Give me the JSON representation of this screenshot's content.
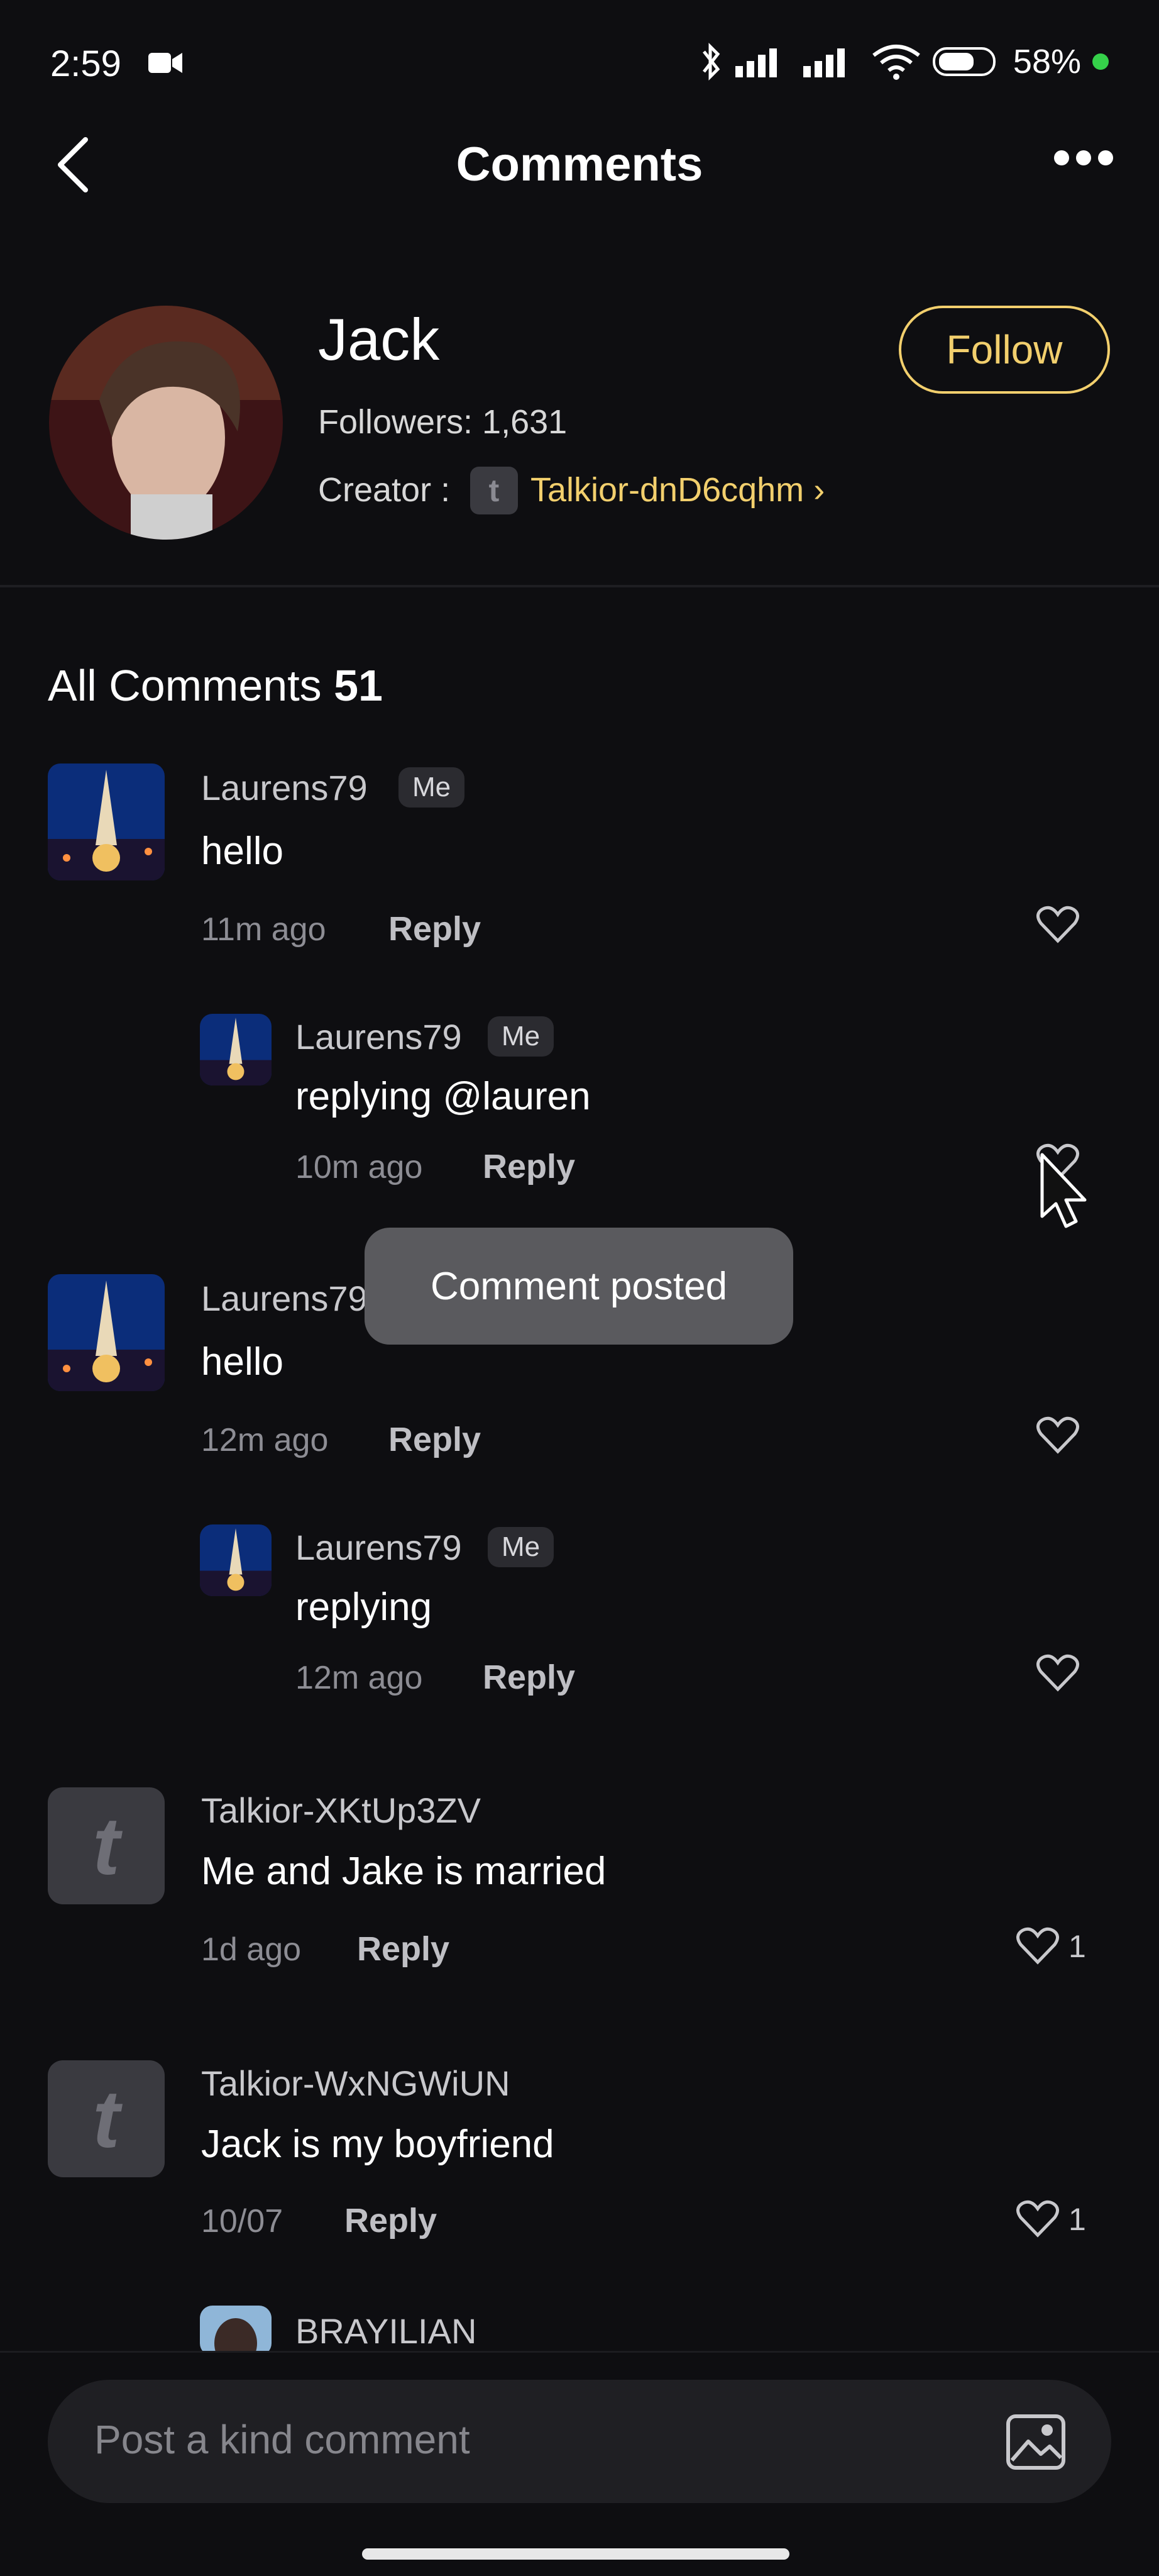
{
  "status_bar": {
    "time": "2:59",
    "battery": "58%"
  },
  "header": {
    "title": "Comments"
  },
  "profile": {
    "name": "Jack",
    "follow_label": "Follow",
    "followers": "Followers: 1,631",
    "creator_label": "Creator :",
    "creator_name": "Talkior-dnD6cqhm",
    "creator_chevron": "›"
  },
  "comments_section": {
    "heading": "All Comments",
    "count": "51"
  },
  "comments": [
    {
      "user": "Laurens79",
      "badge": "Me",
      "text": "hello",
      "time": "11m ago",
      "reply": "Reply"
    },
    {
      "user": "Laurens79",
      "badge": "Me",
      "text": "replying @lauren",
      "time": "10m ago",
      "reply": "Reply"
    },
    {
      "user": "Laurens79",
      "badge": "",
      "text": "hello",
      "time": "12m ago",
      "reply": "Reply"
    },
    {
      "user": "Laurens79",
      "badge": "Me",
      "text": "replying",
      "time": "12m ago",
      "reply": "Reply"
    },
    {
      "user": "Talkior-XKtUp3ZV",
      "text": "Me and Jake is married",
      "time": "1d ago",
      "reply": "Reply",
      "likes": "1"
    },
    {
      "user": "Talkior-WxNGWiUN",
      "text": "Jack is my boyfriend",
      "time": "10/07",
      "reply": "Reply",
      "likes": "1"
    },
    {
      "user": "BRAYILIAN"
    }
  ],
  "toast": {
    "text": "Comment posted"
  },
  "composer": {
    "placeholder": "Post a kind comment"
  },
  "colors": {
    "accent": "#f2cf6d",
    "background": "#0e0e11",
    "toast": "#5a5a5e"
  }
}
